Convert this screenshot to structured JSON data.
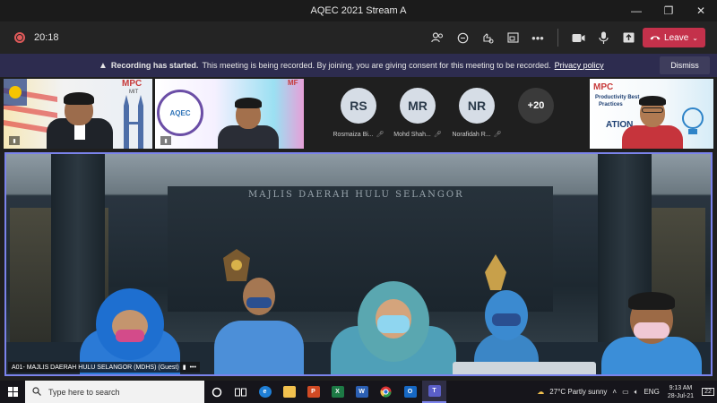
{
  "window": {
    "title": "AQEC 2021 Stream A"
  },
  "toolbar": {
    "timer": "20:18",
    "leave_label": "Leave",
    "icons": [
      "people-icon",
      "chat-icon",
      "reactions-icon",
      "share-tray-icon",
      "more-icon",
      "camera-icon",
      "mic-icon",
      "share-icon"
    ]
  },
  "banner": {
    "bold": "Recording has started.",
    "text": "This meeting is being recorded. By joining, you are giving consent for this meeting to be recorded.",
    "link": "Privacy policy",
    "dismiss_label": "Dismiss"
  },
  "tiles": {
    "tile1_logo": "MPC",
    "tile1_sub": "MIT",
    "tile2_badge": "AQEC",
    "tile2_logo": "MF",
    "tile3_logo": "MPC",
    "tile3_text1": "Productivity Best",
    "tile3_text2": "Practices",
    "tile3_text3": "ATION"
  },
  "participants": [
    {
      "initials": "RS",
      "name": "Rosmaiza Bi..."
    },
    {
      "initials": "MR",
      "name": "Mohd Shah..."
    },
    {
      "initials": "NR",
      "name": "Norafidah R..."
    }
  ],
  "overflow": {
    "count": "+20"
  },
  "stage": {
    "sign": "MAJLIS DAERAH HULU SELANGOR",
    "name_tag": "A01- MAJLIS DAERAH HULU SELANGOR (MDHS) (Guest)"
  },
  "taskbar": {
    "search_placeholder": "Type here to search",
    "weather": "27°C  Partly sunny",
    "language": "ENG",
    "time": "9:13 AM",
    "date": "28-Jul-21",
    "notifications": "22"
  },
  "colors": {
    "accent": "#7b83eb",
    "leave": "#c4314b",
    "banner": "#2d2c4f"
  }
}
